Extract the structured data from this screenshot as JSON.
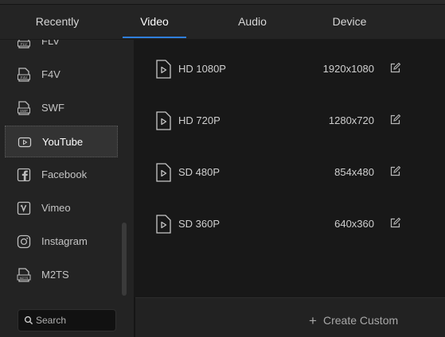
{
  "tabs": [
    {
      "label": "Recently",
      "active": false
    },
    {
      "label": "Video",
      "active": true
    },
    {
      "label": "Audio",
      "active": false
    },
    {
      "label": "Device",
      "active": false
    }
  ],
  "accent_color": "#2f7fdc",
  "sidebar": {
    "items": [
      {
        "label": "FLV",
        "icon": "flv-file-icon",
        "selected": false
      },
      {
        "label": "F4V",
        "icon": "f4v-file-icon",
        "selected": false
      },
      {
        "label": "SWF",
        "icon": "swf-file-icon",
        "selected": false
      },
      {
        "label": "YouTube",
        "icon": "youtube-icon",
        "selected": true
      },
      {
        "label": "Facebook",
        "icon": "facebook-icon",
        "selected": false
      },
      {
        "label": "Vimeo",
        "icon": "vimeo-icon",
        "selected": false
      },
      {
        "label": "Instagram",
        "icon": "instagram-icon",
        "selected": false
      },
      {
        "label": "M2TS",
        "icon": "m2ts-file-icon",
        "selected": false
      }
    ]
  },
  "search": {
    "placeholder": "Search"
  },
  "presets": [
    {
      "name": "HD 1080P",
      "resolution": "1920x1080"
    },
    {
      "name": "HD 720P",
      "resolution": "1280x720"
    },
    {
      "name": "SD 480P",
      "resolution": "854x480"
    },
    {
      "name": "SD 360P",
      "resolution": "640x360"
    }
  ],
  "footer": {
    "create_custom_label": "Create Custom"
  }
}
